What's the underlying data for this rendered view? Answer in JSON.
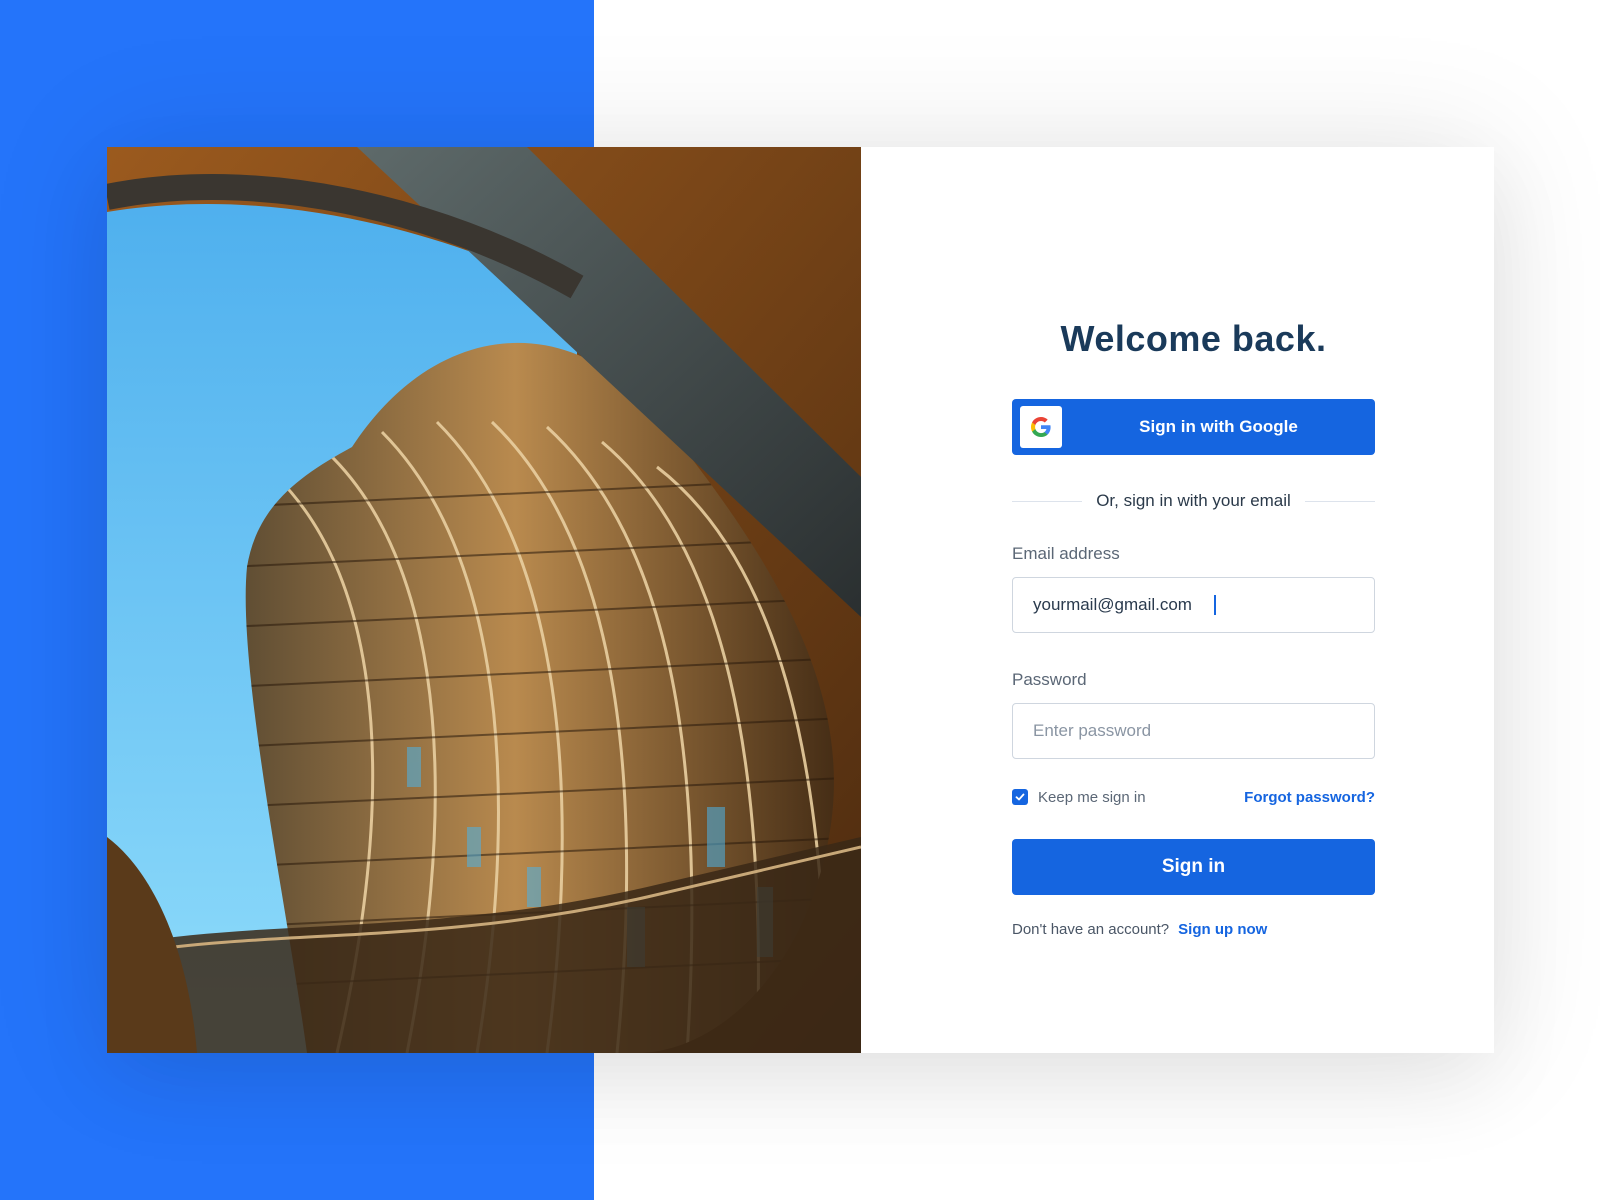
{
  "form": {
    "title": "Welcome back.",
    "google_button_label": "Sign in with Google",
    "divider_text": "Or, sign in with your email",
    "email_label": "Email address",
    "email_value": "yourmail@gmail.com",
    "password_label": "Password",
    "password_placeholder": "Enter password",
    "keep_signed_in_label": "Keep me sign in",
    "keep_signed_in_checked": true,
    "forgot_password_label": "Forgot password?",
    "signin_button_label": "Sign in",
    "no_account_text": "Don't have an account?",
    "signup_link_label": "Sign up now"
  },
  "icons": {
    "google": "google-icon",
    "checkbox": "checkmark-icon"
  },
  "colors": {
    "brand_blue": "#1565e0",
    "background_blue": "#2474fa",
    "title": "#1a3a5a"
  }
}
